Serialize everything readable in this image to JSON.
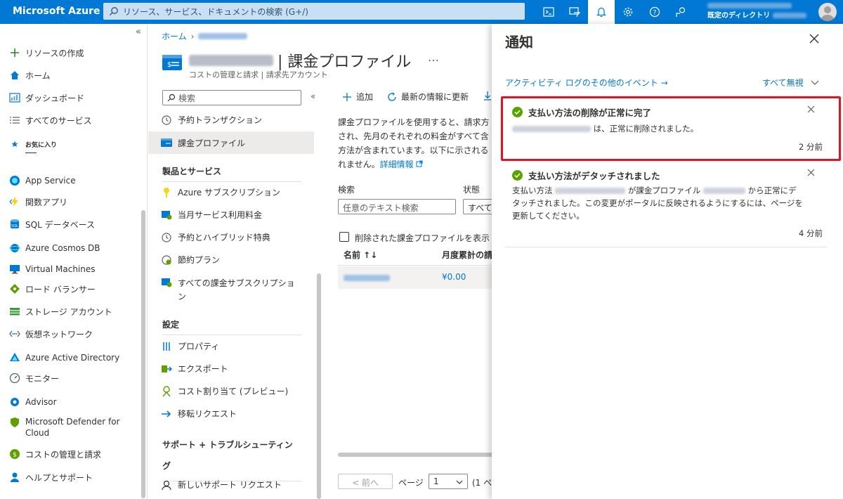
{
  "topbar": {
    "brand": "Microsoft Azure",
    "search_placeholder": "リソース、サービス、ドキュメントの検索 (G+/)",
    "directory_label": "既定のディレクトリ",
    "colors": {
      "bar": "#0078d4",
      "search_bg": "#c7e0f4"
    },
    "icons": [
      "cloud-shell-icon",
      "directory-filter-icon",
      "bell-icon",
      "gear-icon",
      "help-icon",
      "feedback-icon"
    ]
  },
  "leftnav": {
    "collapse_glyph": "«",
    "favorites_label": "お気に入り",
    "items": [
      {
        "label": "リソースの作成",
        "icon": "plus-icon"
      },
      {
        "label": "ホーム",
        "icon": "home-icon"
      },
      {
        "label": "ダッシュボード",
        "icon": "dashboard-icon"
      },
      {
        "label": "すべてのサービス",
        "icon": "list-icon"
      },
      {
        "label": "App Service",
        "icon": "app-service-icon"
      },
      {
        "label": "関数アプリ",
        "icon": "function-app-icon"
      },
      {
        "label": "SQL データベース",
        "icon": "sql-database-icon"
      },
      {
        "label": "Azure Cosmos DB",
        "icon": "cosmos-db-icon"
      },
      {
        "label": "Virtual Machines",
        "icon": "virtual-machine-icon"
      },
      {
        "label": "ロード バランサー",
        "icon": "load-balancer-icon"
      },
      {
        "label": "ストレージ アカウント",
        "icon": "storage-account-icon"
      },
      {
        "label": "仮想ネットワーク",
        "icon": "virtual-network-icon"
      },
      {
        "label": "Azure Active Directory",
        "icon": "active-directory-icon"
      },
      {
        "label": "モニター",
        "icon": "monitor-icon"
      },
      {
        "label": "Advisor",
        "icon": "advisor-icon"
      },
      {
        "label": "Microsoft Defender for",
        "label2": "Cloud",
        "icon": "defender-icon"
      },
      {
        "label": "コストの管理と請求",
        "icon": "cost-management-icon"
      },
      {
        "label": "ヘルプとサポート",
        "icon": "help-support-icon"
      }
    ]
  },
  "blade": {
    "breadcrumb_home": "ホーム",
    "title_suffix": "| 課金プロファイル",
    "subtitle": "コストの管理と請求 | 請求先アカウント",
    "more_glyph": "…",
    "search_placeholder": "検索",
    "menu": {
      "top": [
        {
          "label": "予約トランザクション",
          "icon": "clock-icon"
        },
        {
          "label": "課金プロファイル",
          "icon": "billing-profile-icon",
          "selected": true
        }
      ],
      "sections": [
        {
          "title": "製品とサービス",
          "items": [
            {
              "label": "Azure サブスクリプション",
              "icon": "key-icon"
            },
            {
              "label": "当月サービス利用料金",
              "icon": "charges-icon"
            },
            {
              "label": "予約とハイブリッド特典",
              "icon": "clock-icon"
            },
            {
              "label": "節約プラン",
              "icon": "savings-plan-icon"
            },
            {
              "label": "すべての課金サブスクリプショ",
              "label2": "ン",
              "icon": "billing-subscription-icon"
            }
          ]
        },
        {
          "title": "設定",
          "items": [
            {
              "label": "プロパティ",
              "icon": "properties-icon"
            },
            {
              "label": "エクスポート",
              "icon": "export-icon"
            },
            {
              "label": "コスト割り当て (プレビュー)",
              "icon": "cost-allocation-icon"
            },
            {
              "label": "移転リクエスト",
              "icon": "transfer-icon"
            }
          ]
        },
        {
          "title": "サポート + トラブルシューティン",
          "title2": "グ",
          "items": [
            {
              "label": "新しいサポート リクエスト",
              "icon": "support-request-icon"
            }
          ]
        }
      ]
    },
    "toolbar": {
      "add": "追加",
      "refresh": "最新の情報に更新"
    },
    "description": "課金プロファイルを使用すると、請求方",
    "description_lines": [
      "課金プロファイルを使用すると、請求方",
      "され、先月のそれぞれの料金がすべて含",
      "方法が含まれています。以下に示される",
      "れません。"
    ],
    "learn_more": "詳細情報",
    "filter": {
      "search_label": "検索",
      "search_placeholder": "任意のテキスト検索",
      "status_label": "状態",
      "status_value": "すべて"
    },
    "show_deleted": "削除された課金プロファイルを表示",
    "table": {
      "col_name": "名前 ↑↓",
      "col_month": "月度累計の請",
      "rows": [
        {
          "amount": "¥0.00"
        }
      ]
    },
    "pager": {
      "prev": "< 前へ",
      "page_label": "ページ",
      "page_value": "1",
      "of": "(1 ペ"
    }
  },
  "notifications": {
    "title": "通知",
    "activity_link": "アクティビティ ログのその他のイベント →",
    "dismiss_all": "すべて無視",
    "items": [
      {
        "title": "支払い方法の削除が正常に完了",
        "body": "は、正常に削除されました。",
        "time": "2 分前",
        "highlighted": true
      },
      {
        "title": "支払い方法がデタッチされました",
        "body_a": "支払い方法",
        "body_b": "が課金プロファイル",
        "body_c": "から正常にデ",
        "body_line2": "タッチされました。この変更がポータルに反映されるようにするには、ページを",
        "body_line3": "更新してください。",
        "time": "4 分前"
      }
    ],
    "colors": {
      "success": "#57a300",
      "highlight_border": "#e81123"
    }
  }
}
